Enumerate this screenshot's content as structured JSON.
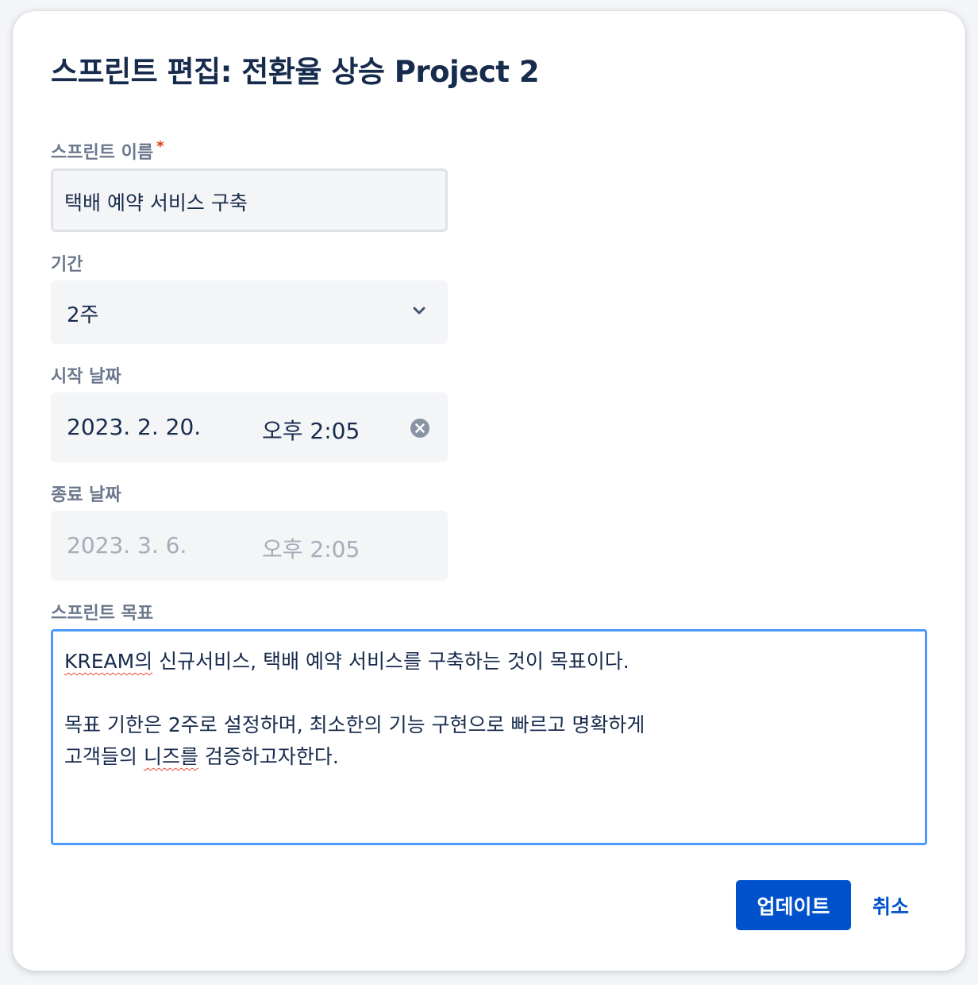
{
  "dialog": {
    "title": "스프린트 편집: 전환율 상승 Project 2"
  },
  "fields": {
    "name": {
      "label": "스프린트 이름",
      "required_mark": "*",
      "value": "택배 예약 서비스 구축"
    },
    "duration": {
      "label": "기간",
      "value": "2주"
    },
    "start_date": {
      "label": "시작 날짜",
      "date": "2023. 2. 20.",
      "time": "오후 2:05"
    },
    "end_date": {
      "label": "종료 날짜",
      "date": "2023. 3. 6.",
      "time": "오후 2:05"
    },
    "goal": {
      "label": "스프린트 목표",
      "line1_word": "KREAM의",
      "line1_rest": " 신규서비스, 택배 예약 서비스를 구축하는 것이 목표이다.",
      "line2": "목표 기한은 2주로 설정하며, 최소한의 기능 구현으로 빠르고 명확하게",
      "line3_pre": "고객들의 ",
      "line3_word": "니즈를",
      "line3_post": " 검증하고자한다."
    }
  },
  "actions": {
    "update_label": "업데이트",
    "cancel_label": "취소"
  },
  "icons": {
    "duration_dropdown": "chevron-down-icon",
    "start_clear": "clear-icon"
  },
  "colors": {
    "primary": "#0052cc",
    "focus_border": "#4c9aff",
    "required": "#de350b",
    "text": "#172b4d",
    "disabled_text": "#a5adba"
  }
}
